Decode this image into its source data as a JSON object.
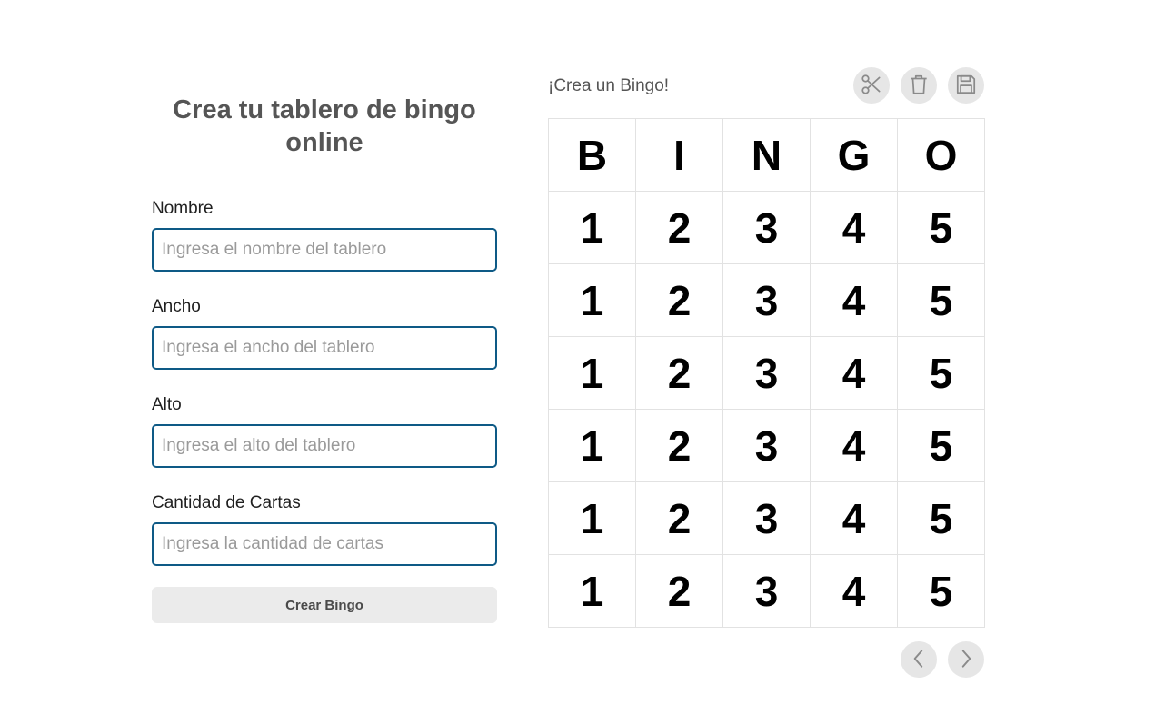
{
  "form": {
    "title": "Crea tu tablero de bingo online",
    "fields": [
      {
        "label": "Nombre",
        "placeholder": "Ingresa el nombre del tablero"
      },
      {
        "label": "Ancho",
        "placeholder": "Ingresa el ancho del tablero"
      },
      {
        "label": "Alto",
        "placeholder": "Ingresa el alto del tablero"
      },
      {
        "label": "Cantidad de Cartas",
        "placeholder": "Ingresa la cantidad de cartas"
      }
    ],
    "submit_label": "Crear Bingo"
  },
  "board": {
    "heading": "¡Crea un Bingo!",
    "toolbar_icons": [
      "scissors-icon",
      "trash-icon",
      "save-icon"
    ],
    "header_letters": [
      "B",
      "I",
      "N",
      "G",
      "O"
    ],
    "rows": [
      [
        "1",
        "2",
        "3",
        "4",
        "5"
      ],
      [
        "1",
        "2",
        "3",
        "4",
        "5"
      ],
      [
        "1",
        "2",
        "3",
        "4",
        "5"
      ],
      [
        "1",
        "2",
        "3",
        "4",
        "5"
      ],
      [
        "1",
        "2",
        "3",
        "4",
        "5"
      ],
      [
        "1",
        "2",
        "3",
        "4",
        "5"
      ]
    ],
    "nav_icons": [
      "chevron-left-icon",
      "chevron-right-icon"
    ]
  },
  "colors": {
    "input_border": "#0e5a86",
    "button_bg": "#ebebeb",
    "icon_button_bg": "#e6e6e6",
    "icon_stroke": "#8a8a8a"
  }
}
